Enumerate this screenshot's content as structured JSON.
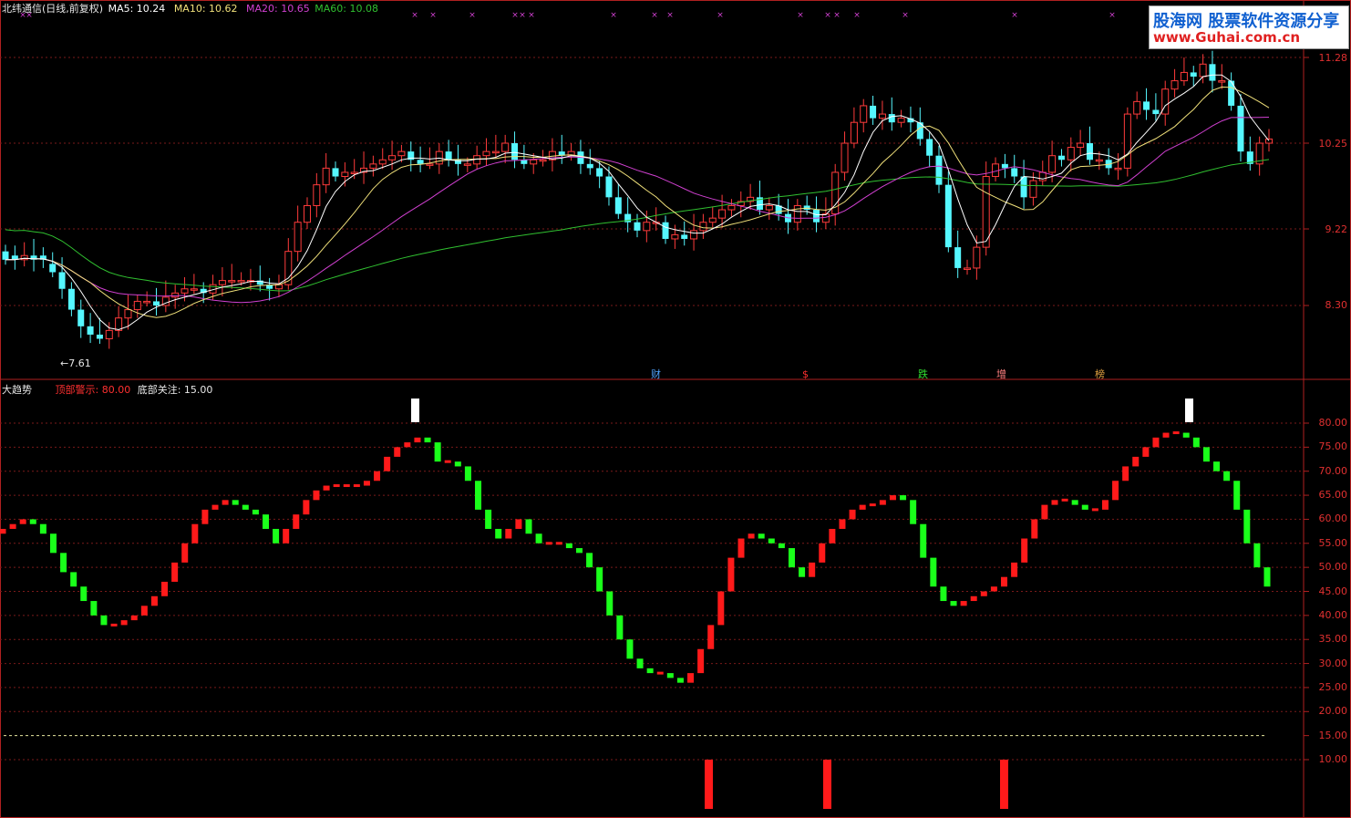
{
  "top_chart": {
    "stock_name": "北纬通信(日线,前复权)",
    "ma5": "MA5: 10.24",
    "ma10": "MA10: 10.62",
    "ma20": "MA20: 10.65",
    "ma60": "MA60: 10.08",
    "low_label": "7.61",
    "price_ticks": [
      "11.28",
      "10.25",
      "9.22",
      "8.30"
    ],
    "event_markers": [
      {
        "label": "财",
        "color": "#4fa3ff"
      },
      {
        "label": "$",
        "color": "#ff3030"
      },
      {
        "label": "跌",
        "color": "#30e030"
      },
      {
        "label": "增",
        "color": "#ff8080"
      },
      {
        "label": "榜",
        "color": "#e0a040"
      }
    ],
    "colors": {
      "up": "#ff3b3b",
      "down": "#55f7ff",
      "ma5": "#ffffff",
      "ma10": "#f0e07a",
      "ma20": "#d040d0",
      "ma60": "#30c030"
    }
  },
  "indicator": {
    "name": "大趋势",
    "top_warning": "顶部警示: 80.00",
    "bottom_watch": "底部关注: 15.00",
    "ticks": [
      "80.00",
      "75.00",
      "70.00",
      "65.00",
      "60.00",
      "55.00",
      "50.00",
      "45.00",
      "40.00",
      "35.00",
      "30.00",
      "25.00",
      "20.00",
      "15.00",
      "10.00"
    ],
    "colors": {
      "rise": "#ff1a1a",
      "fall": "#1aff1a",
      "signal_top": "#ffffff",
      "signal_bottom": "#ff1a1a"
    }
  },
  "logo": {
    "line1": "股海网 股票软件资源分享",
    "line2": "www.Guhai.com.cn"
  },
  "chart_data": [
    {
      "type": "candlestick",
      "title": "北纬通信(日线,前复权)",
      "y_ticks": [
        11.28,
        10.25,
        9.22,
        8.3
      ],
      "ylim": [
        7.5,
        11.5
      ],
      "annotations": [
        "7.61"
      ],
      "series": [
        {
          "name": "MA5",
          "last": 10.24
        },
        {
          "name": "MA10",
          "last": 10.62
        },
        {
          "name": "MA20",
          "last": 10.65
        },
        {
          "name": "MA60",
          "last": 10.08
        }
      ],
      "close": [
        8.85,
        8.85,
        8.9,
        8.85,
        8.85,
        8.7,
        8.5,
        8.25,
        8.05,
        7.95,
        7.9,
        8.0,
        8.15,
        8.25,
        8.35,
        8.35,
        8.3,
        8.4,
        8.45,
        8.5,
        8.5,
        8.45,
        8.55,
        8.6,
        8.6,
        8.6,
        8.6,
        8.55,
        8.5,
        8.55,
        8.95,
        9.3,
        9.5,
        9.75,
        9.95,
        9.85,
        9.9,
        9.9,
        9.95,
        10.0,
        10.05,
        10.1,
        10.15,
        10.05,
        10.0,
        10.0,
        10.15,
        10.05,
        10.0,
        10.0,
        10.1,
        10.15,
        10.15,
        10.25,
        10.05,
        10.0,
        10.05,
        10.05,
        10.15,
        10.1,
        10.15,
        10.0,
        9.95,
        9.85,
        9.6,
        9.4,
        9.3,
        9.2,
        9.3,
        9.3,
        9.1,
        9.15,
        9.1,
        9.2,
        9.3,
        9.35,
        9.45,
        9.5,
        9.55,
        9.6,
        9.45,
        9.5,
        9.4,
        9.3,
        9.5,
        9.45,
        9.3,
        9.4,
        9.9,
        10.25,
        10.5,
        10.7,
        10.55,
        10.6,
        10.5,
        10.55,
        10.5,
        10.3,
        10.1,
        9.75,
        9.0,
        8.75,
        8.75,
        9.0,
        9.85,
        10.0,
        9.95,
        9.85,
        9.6,
        9.8,
        9.9,
        10.1,
        10.05,
        10.2,
        10.25,
        10.05,
        10.05,
        9.95,
        9.95,
        10.6,
        10.75,
        10.65,
        10.6,
        10.9,
        11.0,
        11.1,
        11.05,
        11.2,
        11.0,
        11.0,
        10.7,
        10.15,
        10.0,
        10.25,
        10.3
      ],
      "open": [
        8.95,
        8.9,
        8.85,
        8.9,
        8.9,
        8.8,
        8.7,
        8.5,
        8.25,
        8.05,
        7.95,
        7.9,
        8.0,
        8.15,
        8.25,
        8.35,
        8.35,
        8.3,
        8.4,
        8.45,
        8.5,
        8.5,
        8.45,
        8.55,
        8.6,
        8.6,
        8.6,
        8.6,
        8.55,
        8.5,
        8.55,
        8.95,
        9.3,
        9.5,
        9.75,
        9.95,
        9.85,
        9.9,
        9.9,
        9.95,
        10.0,
        10.05,
        10.1,
        10.15,
        10.05,
        10.0,
        10.0,
        10.15,
        10.05,
        10.0,
        10.0,
        10.1,
        10.15,
        10.15,
        10.25,
        10.05,
        10.0,
        10.05,
        10.05,
        10.15,
        10.1,
        10.15,
        10.0,
        9.95,
        9.85,
        9.6,
        9.4,
        9.3,
        9.2,
        9.3,
        9.3,
        9.1,
        9.15,
        9.1,
        9.2,
        9.3,
        9.35,
        9.45,
        9.5,
        9.55,
        9.6,
        9.45,
        9.5,
        9.4,
        9.3,
        9.5,
        9.45,
        9.3,
        9.4,
        9.9,
        10.25,
        10.5,
        10.7,
        10.55,
        10.6,
        10.5,
        10.55,
        10.5,
        10.3,
        10.1,
        9.75,
        9.0,
        8.75,
        8.75,
        9.0,
        9.85,
        10.0,
        9.95,
        9.85,
        9.6,
        9.8,
        9.9,
        10.1,
        10.05,
        10.2,
        10.25,
        10.05,
        10.05,
        9.95,
        9.95,
        10.6,
        10.75,
        10.65,
        10.6,
        10.9,
        11.0,
        11.1,
        11.05,
        11.2,
        11.0,
        11.0,
        10.7,
        10.15,
        10.0,
        10.25
      ]
    },
    {
      "type": "bar",
      "title": "大趋势",
      "y_ticks": [
        80,
        75,
        70,
        65,
        60,
        55,
        50,
        45,
        40,
        35,
        30,
        25,
        20,
        15,
        10
      ],
      "ylim": [
        5,
        85
      ],
      "reference_lines": [
        {
          "name": "顶部警示",
          "value": 80.0
        },
        {
          "name": "底部关注",
          "value": 15.0
        }
      ],
      "values": [
        58,
        59,
        60,
        59,
        57,
        53,
        49,
        46,
        43,
        40,
        38,
        38,
        39,
        40,
        42,
        44,
        47,
        51,
        55,
        59,
        62,
        63,
        64,
        63,
        62,
        61,
        58,
        55,
        58,
        61,
        64,
        66,
        67,
        67,
        67,
        67,
        68,
        70,
        73,
        75,
        76,
        77,
        76,
        72,
        72,
        71,
        68,
        62,
        58,
        56,
        58,
        60,
        57,
        55,
        55,
        55,
        54,
        53,
        50,
        45,
        40,
        35,
        31,
        29,
        28,
        28,
        27,
        26,
        28,
        33,
        38,
        45,
        52,
        56,
        57,
        56,
        55,
        54,
        50,
        48,
        51,
        55,
        58,
        60,
        62,
        63,
        63,
        64,
        65,
        64,
        59,
        52,
        46,
        43,
        42,
        43,
        44,
        45,
        46,
        48,
        51,
        56,
        60,
        63,
        64,
        64,
        63,
        62,
        62,
        64,
        68,
        71,
        73,
        75,
        77,
        78,
        78,
        77,
        75,
        72,
        70,
        68,
        62,
        55,
        50,
        46
      ]
    }
  ]
}
